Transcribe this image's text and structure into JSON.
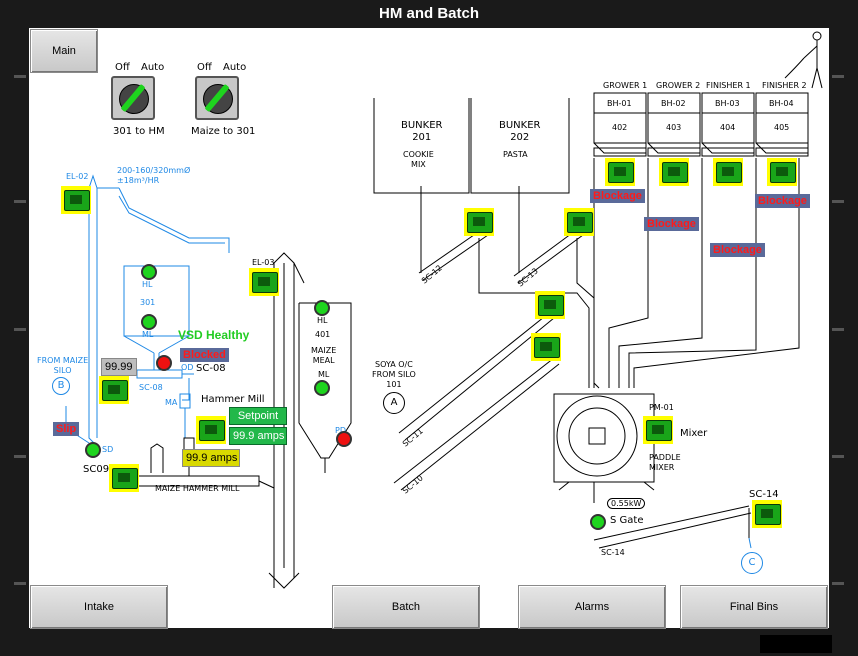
{
  "window": {
    "title": "HM and Batch"
  },
  "nav": {
    "main": "Main",
    "intake": "Intake",
    "batch": "Batch",
    "alarms": "Alarms",
    "final_bins": "Final Bins"
  },
  "switches": [
    {
      "off": "Off",
      "auto": "Auto",
      "label": "301 to HM"
    },
    {
      "off": "Off",
      "auto": "Auto",
      "label": "Maize to 301"
    }
  ],
  "bunkers": [
    {
      "name": "BUNKER\n201",
      "content": "COOKIE\nMIX"
    },
    {
      "name": "BUNKER\n202",
      "content": "PASTA"
    }
  ],
  "bins": [
    {
      "group": "GROWER 1",
      "id": "BH-01",
      "num": "402"
    },
    {
      "group": "GROWER 2",
      "id": "BH-02",
      "num": "403"
    },
    {
      "group": "FINISHER 1",
      "id": "BH-03",
      "num": "404"
    },
    {
      "group": "FINISHER 2",
      "id": "BH-04",
      "num": "405"
    }
  ],
  "labels": {
    "el02": "EL-02",
    "el02_spec": "200-160/320mmØ\n±18m³/HR",
    "el03": "EL-03",
    "from_maize": "FROM MAIZE\nSILO",
    "circle_b": "B",
    "hl": "HL",
    "ml": "ML",
    "bin301": "301",
    "sc08": "SC-08",
    "sc08_tag": "SC-08",
    "od": "OD",
    "ma": "MA",
    "sd": "SD",
    "sc09": "SC09",
    "hammer_mill": "Hammer Mill",
    "maize_hammer_mill": "MAIZE HAMMER MILL",
    "bin401": "401",
    "maize_meal": "MAIZE\nMEAL",
    "pd": "PD",
    "soya": "SOYA O/C\nFROM SILO\n101",
    "circle_a": "A",
    "sc10": "SC-10",
    "sc11": "SC-11",
    "sc12": "SC-12",
    "sc13": "SC-13",
    "pm01": "PM-01",
    "mixer": "Mixer",
    "paddle_mixer": "PADDLE\nMIXER",
    "power": "0.55kW",
    "s_gate": "S Gate",
    "sc14": "SC-14",
    "sc14_bottom": "SC-14",
    "circle_c": "C"
  },
  "status": {
    "vsd": "VSD Healthy",
    "blocked": "Blocked",
    "slip": "Slip",
    "blockage": "Blockage"
  },
  "values": {
    "sc08_speed": "99.99",
    "setpoint_label": "Setpoint",
    "setpoint_value": "99.9 amps",
    "hm_current": "99.9 amps"
  },
  "colors": {
    "motor_bg": "#ffff00",
    "motor_green": "#19a519",
    "alarm_red": "#ff1a1a",
    "alarm_bg": "#5a6a9a",
    "healthy_green": "#22cc22",
    "line_blue": "#1e88e5"
  }
}
